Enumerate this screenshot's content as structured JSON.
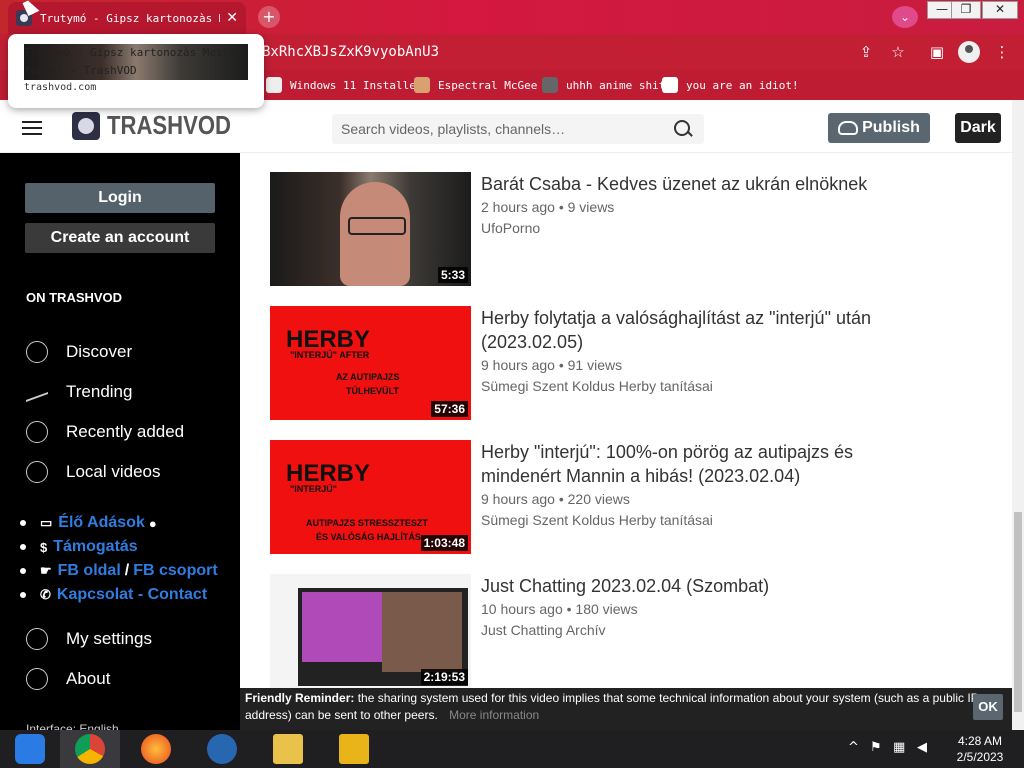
{
  "browser": {
    "tab_title": "Trutymó - Gipsz kartonozàs Mest",
    "tab_close": "✕",
    "new_tab": "+",
    "url": "BxRhcXBJsZxK9vyobAnU3",
    "window_buttons": [
      "—",
      "❐",
      "✕"
    ],
    "tooltip": {
      "title": "Trutymó - Gipsz kartonozàs Mester fokon! - TrashVOD",
      "domain": "trashvod.com"
    },
    "bookmarks": [
      "Windows 11 Installer",
      "Espectral McGee",
      "uhhh anime shit",
      "you are an idiot!"
    ],
    "colors": {
      "chrome": "#c21f35"
    }
  },
  "site": {
    "logo_text": "TRASHVOD",
    "search_placeholder": "Search videos, playlists, channels…",
    "publish_label": "Publish",
    "dark_label": "Dark"
  },
  "sidebar": {
    "login_label": "Login",
    "create_label": "Create an account",
    "section_title": "ON TRASHVOD",
    "nav": [
      {
        "label": "Discover",
        "icon": "globe-icon"
      },
      {
        "label": "Trending",
        "icon": "trending-icon"
      },
      {
        "label": "Recently added",
        "icon": "plus-circle-icon"
      },
      {
        "label": "Local videos",
        "icon": "home-icon"
      }
    ],
    "links": {
      "live": "Élő Adások",
      "support": "Támogatás",
      "fb_page": "FB oldal",
      "separator": "/",
      "fb_group": "FB csoport",
      "contact": "Kapcsolat - Contact"
    },
    "settings": [
      {
        "label": "My settings",
        "icon": "gear-icon"
      },
      {
        "label": "About",
        "icon": "help-icon"
      }
    ],
    "footer_cut": "Interface: English"
  },
  "videos": [
    {
      "title": "Barát Csaba - Kedves üzenet az ukrán elnöknek",
      "meta": "2 hours ago • 9 views",
      "channel": "UfoPorno",
      "duration": "5:33"
    },
    {
      "title": "Herby folytatja a valósághajlítást az \"interjú\" után (2023.02.05)",
      "meta": "9 hours ago • 91 views",
      "channel": "Sümegi Szent Koldus Herby tanításai",
      "duration": "57:36",
      "thumb": {
        "heading": "HERBY",
        "sub": "\"INTERJÚ\" AFTER",
        "line1": "AZ AUTIPAJZS",
        "line2": "TÚLHEVÜLT"
      }
    },
    {
      "title": "Herby \"interjú\": 100%-on pörög az autipajzs és mindenért Mannin a hibás! (2023.02.04)",
      "meta": "9 hours ago • 220 views",
      "channel": "Sümegi Szent Koldus Herby tanításai",
      "duration": "1:03:48",
      "thumb": {
        "heading": "HERBY",
        "sub": "\"INTERJÚ\"",
        "line1": "AUTIPAJZS STRESSZTESZT",
        "line2": "ÉS VALÓSÁG HAJLÍTÁS"
      }
    },
    {
      "title": "Just Chatting 2023.02.04 (Szombat)",
      "meta": "10 hours ago • 180 views",
      "channel": "Just Chatting Archív",
      "duration": "2:19:53"
    }
  ],
  "reminder": {
    "label": "Friendly Reminder:",
    "text": "the sharing system used for this video implies that some technical information about your system (such as a public IP address) can be sent to other peers.",
    "more": "More information",
    "ok": "OK"
  },
  "taskbar": {
    "time": "4:28 AM",
    "date": "2/5/2023"
  }
}
